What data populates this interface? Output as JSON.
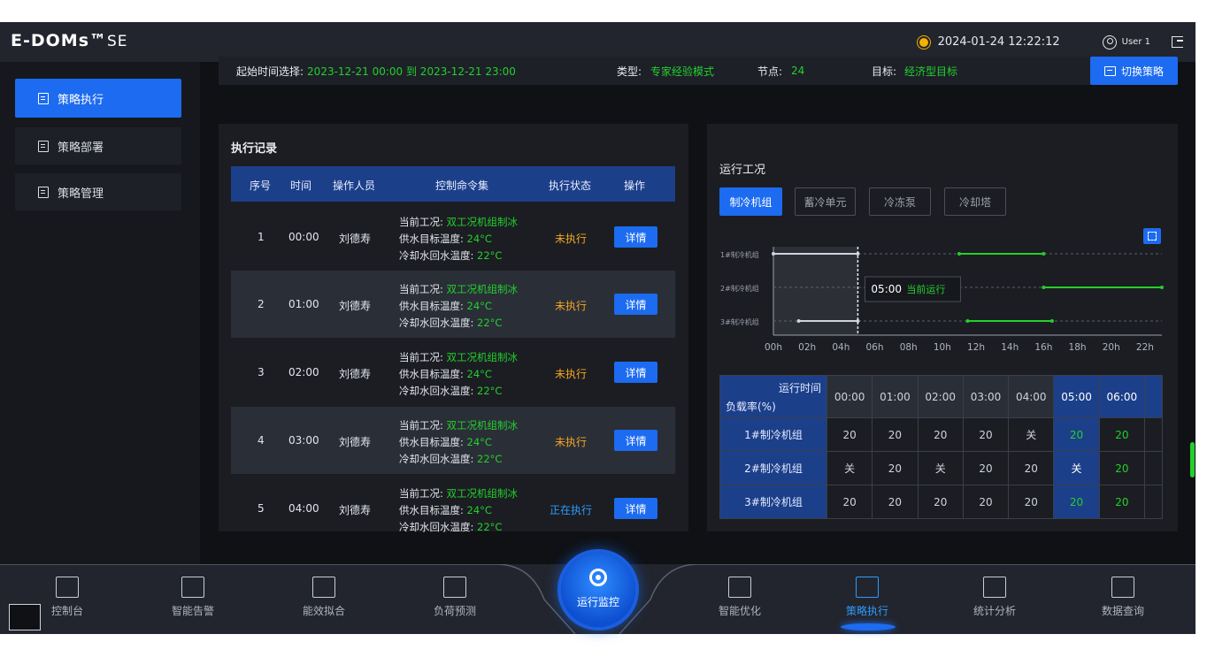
{
  "header": {
    "logo": "E-DOMs™",
    "logo_suffix": "SE",
    "datetime": "2024-01-24  12:22:12",
    "user": "User 1"
  },
  "sidebar": {
    "items": [
      {
        "label": "策略执行",
        "active": true
      },
      {
        "label": "策略部署",
        "active": false
      },
      {
        "label": "策略管理",
        "active": false
      }
    ]
  },
  "infobar": {
    "range_label": "起始时间选择:",
    "range_value": "2023-12-21 00:00 到 2023-12-21 23:00",
    "type_label": "类型:",
    "type_value": "专家经验模式",
    "node_label": "节点:",
    "node_value": "24",
    "target_label": "目标:",
    "target_value": "经济型目标",
    "switch_label": "切换策略"
  },
  "records": {
    "title": "执行记录",
    "headers": [
      "序号",
      "时间",
      "操作人员",
      "控制命令集",
      "执行状态",
      "操作"
    ],
    "cmd_labels": [
      "当前工况: ",
      "供水目标温度: ",
      "冷却水回水温度: "
    ],
    "rows": [
      {
        "idx": "1",
        "time": "00:00",
        "operator": "刘德寿",
        "mode": "双工况机组制冰",
        "supply": "24°C",
        "return": "22°C",
        "status": "未执行",
        "action": "详情"
      },
      {
        "idx": "2",
        "time": "01:00",
        "operator": "刘德寿",
        "mode": "双工况机组制冰",
        "supply": "24°C",
        "return": "22°C",
        "status": "未执行",
        "action": "详情"
      },
      {
        "idx": "3",
        "time": "02:00",
        "operator": "刘德寿",
        "mode": "双工况机组制冰",
        "supply": "24°C",
        "return": "22°C",
        "status": "未执行",
        "action": "详情"
      },
      {
        "idx": "4",
        "time": "03:00",
        "operator": "刘德寿",
        "mode": "双工况机组制冰",
        "supply": "24°C",
        "return": "22°C",
        "status": "未执行",
        "action": "详情"
      },
      {
        "idx": "5",
        "time": "04:00",
        "operator": "刘德寿",
        "mode": "双工况机组制冰",
        "supply": "24°C",
        "return": "22°C",
        "status": "正在执行",
        "action": "详情"
      }
    ]
  },
  "operating": {
    "title": "运行工况",
    "tabs": [
      {
        "label": "制冷机组",
        "active": true
      },
      {
        "label": "蓄冷单元",
        "active": false
      },
      {
        "label": "冷冻泵",
        "active": false
      },
      {
        "label": "冷却塔",
        "active": false
      }
    ],
    "tooltip_time": "05:00",
    "tooltip_text": "当前运行"
  },
  "chart_data": {
    "type": "gantt",
    "categories": [
      "1#制冷机组",
      "2#制冷机组",
      "3#制冷机组"
    ],
    "x_ticks": [
      "00h",
      "02h",
      "04h",
      "06h",
      "08h",
      "10h",
      "12h",
      "14h",
      "16h",
      "18h",
      "20h",
      "22h"
    ],
    "xlim": [
      0,
      23
    ],
    "current_hour": 5,
    "series": [
      {
        "name": "",
        "color": "#cfd3dc",
        "segments": [
          [
            0,
            0,
            5
          ],
          [
            2,
            1.5,
            5
          ]
        ]
      },
      {
        "name": "",
        "color": "#23d02c",
        "segments": [
          [
            0,
            11,
            16
          ],
          [
            1,
            16,
            23
          ],
          [
            2,
            11.5,
            16.5
          ]
        ]
      }
    ]
  },
  "load_table": {
    "corner_top": "运行时间",
    "corner_bottom": "负载率(%)",
    "times": [
      "00:00",
      "01:00",
      "02:00",
      "03:00",
      "04:00",
      "05:00",
      "06:00"
    ],
    "current_index": 5,
    "rows": [
      {
        "name": "1#制冷机组",
        "values": [
          "20",
          "20",
          "20",
          "20",
          "关",
          "20",
          "20"
        ]
      },
      {
        "name": "2#制冷机组",
        "values": [
          "关",
          "20",
          "关",
          "20",
          "20",
          "关",
          "20"
        ]
      },
      {
        "name": "3#制冷机组",
        "values": [
          "20",
          "20",
          "20",
          "20",
          "20",
          "20",
          "20"
        ]
      }
    ]
  },
  "bottom_nav": {
    "items": [
      {
        "label": "控制台",
        "icon": "monitor-icon"
      },
      {
        "label": "智能告警",
        "icon": "alarm-icon"
      },
      {
        "label": "能效拟合",
        "icon": "cube-icon"
      },
      {
        "label": "负荷预测",
        "icon": "trend-icon"
      },
      {
        "label": "智能优化",
        "icon": "sliders-icon"
      },
      {
        "label": "策略执行",
        "icon": "checklist-icon"
      },
      {
        "label": "统计分析",
        "icon": "bar-chart-icon"
      },
      {
        "label": "数据查询",
        "icon": "search-doc-icon"
      }
    ],
    "center_label": "运行监控"
  },
  "colors": {
    "accent": "#1c6bf0",
    "green": "#23d02c",
    "orange": "#f5a623",
    "blue_status": "#2e9bff"
  }
}
